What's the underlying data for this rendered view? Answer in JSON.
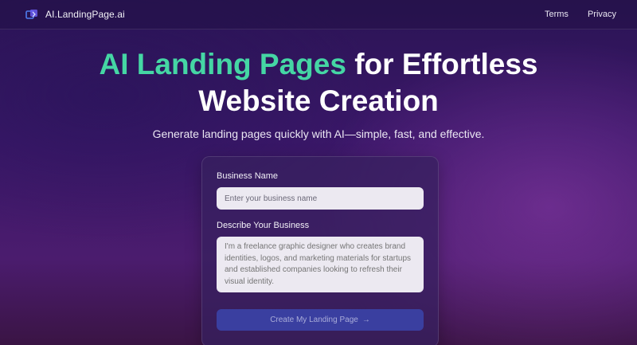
{
  "nav": {
    "brand": "AI.LandingPage.ai",
    "links": [
      "Terms",
      "Privacy"
    ]
  },
  "hero": {
    "title_accent": "AI Landing Pages",
    "title_rest_line1": " for Effortless",
    "title_line2": "Website Creation",
    "subtitle": "Generate landing pages quickly with AI—simple, fast, and effective."
  },
  "form": {
    "business_name_label": "Business Name",
    "business_name_placeholder": "Enter your business name",
    "describe_label": "Describe Your Business",
    "describe_placeholder": "I'm a freelance graphic designer who creates brand identities, logos, and marketing materials for startups and established companies looking to refresh their visual identity.",
    "submit_label": "Create My Landing Page",
    "submit_icon": "→"
  },
  "colors": {
    "accent": "#45d6a4",
    "button": "#3a3fa0",
    "background": "#3a1768"
  },
  "icons": {
    "brand": "layers-logo-icon",
    "submit": "arrow-right-icon"
  }
}
